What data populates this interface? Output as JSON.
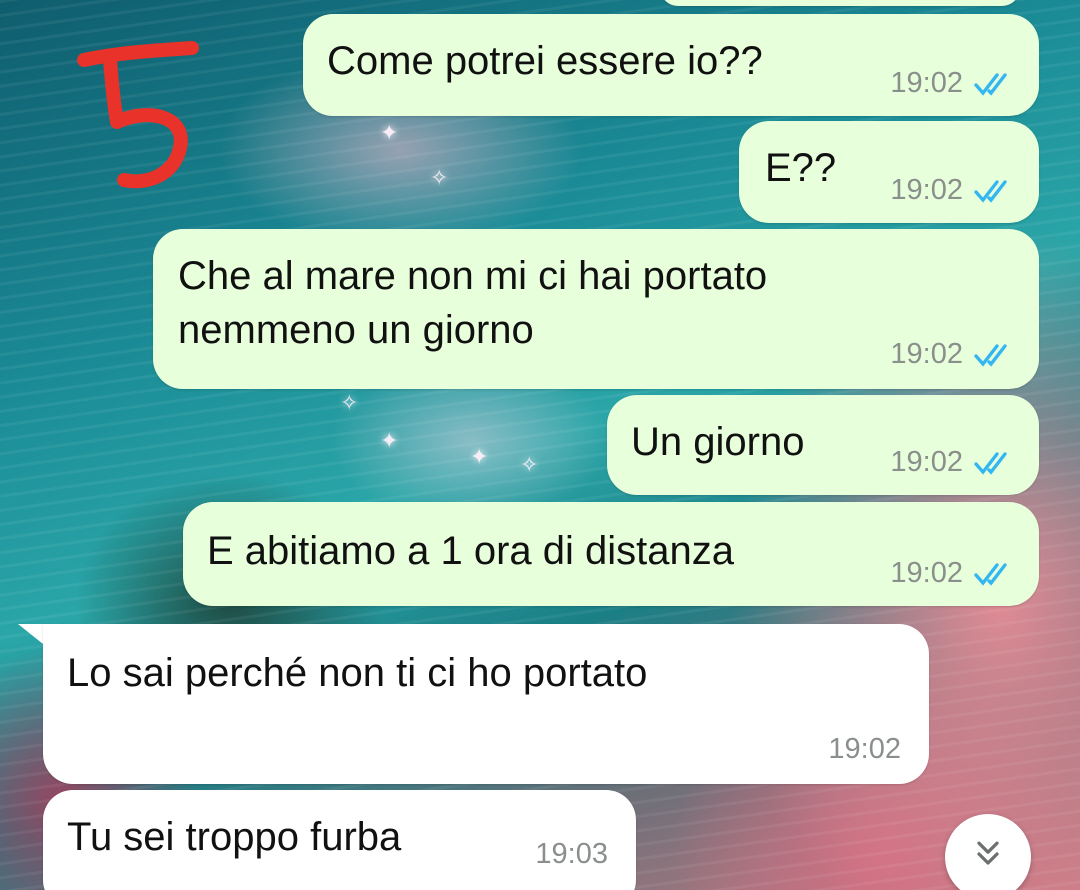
{
  "annotation": {
    "number": "5"
  },
  "messages": [
    {
      "direction": "outgoing",
      "text": "Come potrei essere io??",
      "time": "19:02",
      "status": "read"
    },
    {
      "direction": "outgoing",
      "text": "E??",
      "time": "19:02",
      "status": "read"
    },
    {
      "direction": "outgoing",
      "text": "Che al mare non mi ci hai portato\nnemmeno un giorno",
      "time": "19:02",
      "status": "read"
    },
    {
      "direction": "outgoing",
      "text": "Un giorno",
      "time": "19:02",
      "status": "read"
    },
    {
      "direction": "outgoing",
      "text": "E abitiamo a 1 ora di distanza",
      "time": "19:02",
      "status": "read"
    },
    {
      "direction": "incoming",
      "text": "Lo sai perché non ti ci ho portato",
      "time": "19:02"
    },
    {
      "direction": "incoming",
      "text": "Tu sei troppo furba",
      "time": "19:03"
    }
  ],
  "scroll_button": {
    "icon": "double-chevron-down-icon"
  },
  "colors": {
    "outgoing_bubble": "#e7ffdb",
    "incoming_bubble": "#ffffff",
    "read_ticks": "#34b7f1",
    "annotation": "#e8322a",
    "timestamp": "#8a8f8c"
  }
}
